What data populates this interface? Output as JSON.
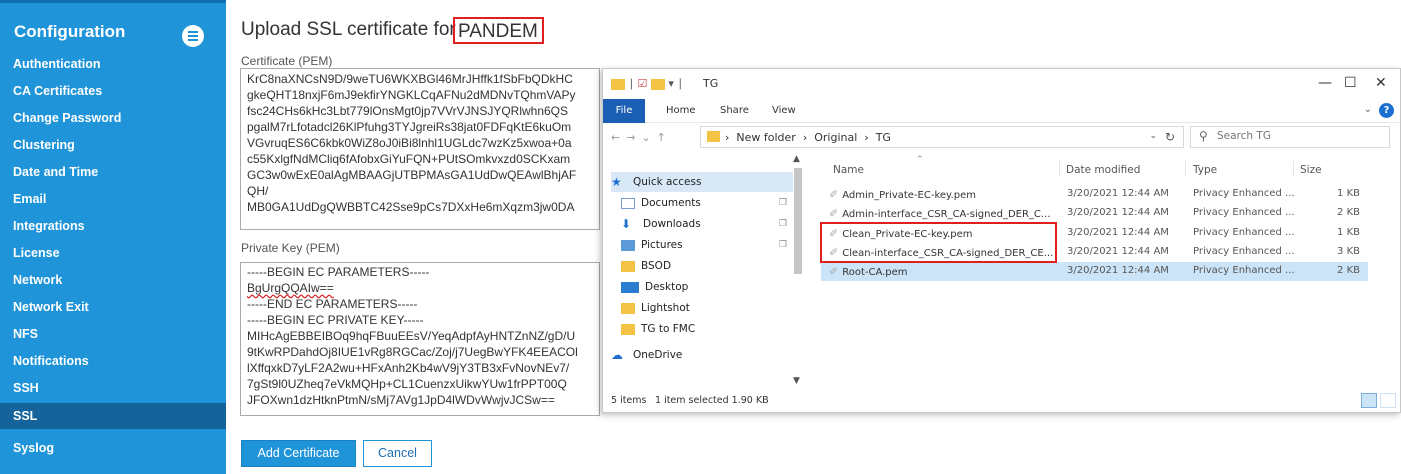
{
  "sidebar": {
    "title": "Configuration",
    "items": [
      {
        "label": "Authentication"
      },
      {
        "label": "CA Certificates"
      },
      {
        "label": "Change Password"
      },
      {
        "label": "Clustering"
      },
      {
        "label": "Date and Time"
      },
      {
        "label": "Email"
      },
      {
        "label": "Integrations"
      },
      {
        "label": "License"
      },
      {
        "label": "Network"
      },
      {
        "label": "Network Exit"
      },
      {
        "label": "NFS"
      },
      {
        "label": "Notifications"
      },
      {
        "label": "SSH"
      },
      {
        "label": "SSL"
      },
      {
        "label": "Syslog"
      }
    ],
    "active": "SSL"
  },
  "main": {
    "title_prefix": "Upload SSL certificate for",
    "title_device": "PANDEM",
    "certificate_label": "Certificate (PEM)",
    "certificate_lines": [
      "KrC8naXNCsN9D/9weTU6WKXBGl46MrJHffk1fSbFbQDkHC",
      "gkeQHT18nxjF6mJ9ekfirYNGKLCqAFNu2dMDNvTQhmVAPy",
      "fsc24CHs6kHc3Lbt779lOnsMgt0jp7VVrVJNSJYQRlwhn6QS",
      "pgalM7rLfotadcl26KlPfuhg3TYJgreiRs38jat0FDFqKtE6kuOm",
      "VGvruqES6C6kbk0WiZ8oJ0iBi8lnhl1UGLdc7wzKz5xwoa+0a",
      "c55KxlgfNdMCliq6fAfobxGiYuFQN+PUtSOmkvxzd0SCKxam",
      "GC3w0wExE0alAgMBAAGjUTBPMAsGA1UdDwQEAwlBhjAF",
      "QH/",
      "MB0GA1UdDgQWBBTC42Sse9pCs7DXxHe6mXqzm3jw0DA"
    ],
    "private_key_label": "Private Key (PEM)",
    "private_key_lines": [
      "-----BEGIN EC PARAMETERS-----",
      "BgUrgQQAIw==",
      "-----END EC PARAMETERS-----",
      "-----BEGIN EC PRIVATE KEY-----",
      "MIHcAgEBBEIBOq9hqFBuuEEsV/YeqAdpfAyHNTZnNZ/gD/U",
      "9tKwRPDahdOj8IUE1vRg8RGCac/Zoj/j7UegBwYFK4EEACOl",
      "lXffqxkD7yLF2A2wu+HFxAnh2Kb4wV9jY3TB3xFvNovNEv7/",
      "7gSt9l0UZheq7eVkMQHp+CL1CuenzxUikwYUw1frPPT00Q",
      "JFOXwn1dzHtknPtmN/sMj7AVg1JpD4lWDvWwjvJCSw=="
    ],
    "add_button": "Add Certificate",
    "cancel_button": "Cancel"
  },
  "explorer": {
    "title": "TG",
    "ribbon_tabs": [
      "File",
      "Home",
      "Share",
      "View"
    ],
    "path": [
      "New folder",
      "Original",
      "TG"
    ],
    "search_placeholder": "Search TG",
    "columns": {
      "name": "Name",
      "date": "Date modified",
      "type": "Type",
      "size": "Size"
    },
    "nav": [
      {
        "label": "Quick access",
        "icon": "star-icon"
      },
      {
        "label": "Documents",
        "icon": "documents-icon"
      },
      {
        "label": "Downloads",
        "icon": "download-icon"
      },
      {
        "label": "Pictures",
        "icon": "pictures-icon"
      },
      {
        "label": "BSOD",
        "icon": "folder-icon"
      },
      {
        "label": "Desktop",
        "icon": "desktop-icon"
      },
      {
        "label": "Lightshot",
        "icon": "folder-icon"
      },
      {
        "label": "TG to FMC",
        "icon": "folder-icon"
      },
      {
        "label": "OneDrive",
        "icon": "cloud-icon"
      }
    ],
    "files": [
      {
        "name": "Admin_Private-EC-key.pem",
        "date": "3/20/2021 12:44 AM",
        "type": "Privacy Enhanced ...",
        "size": "1 KB"
      },
      {
        "name": "Admin-interface_CSR_CA-signed_DER_C...",
        "date": "3/20/2021 12:44 AM",
        "type": "Privacy Enhanced ...",
        "size": "2 KB"
      },
      {
        "name": "Clean_Private-EC-key.pem",
        "date": "3/20/2021 12:44 AM",
        "type": "Privacy Enhanced ...",
        "size": "1 KB"
      },
      {
        "name": "Clean-interface_CSR_CA-signed_DER_CE...",
        "date": "3/20/2021 12:44 AM",
        "type": "Privacy Enhanced ...",
        "size": "3 KB"
      },
      {
        "name": "Root-CA.pem",
        "date": "3/20/2021 12:44 AM",
        "type": "Privacy Enhanced ...",
        "size": "2 KB"
      }
    ],
    "selected_file": "Root-CA.pem",
    "status_items": "5 items",
    "status_selected": "1 item selected  1.90 KB"
  }
}
